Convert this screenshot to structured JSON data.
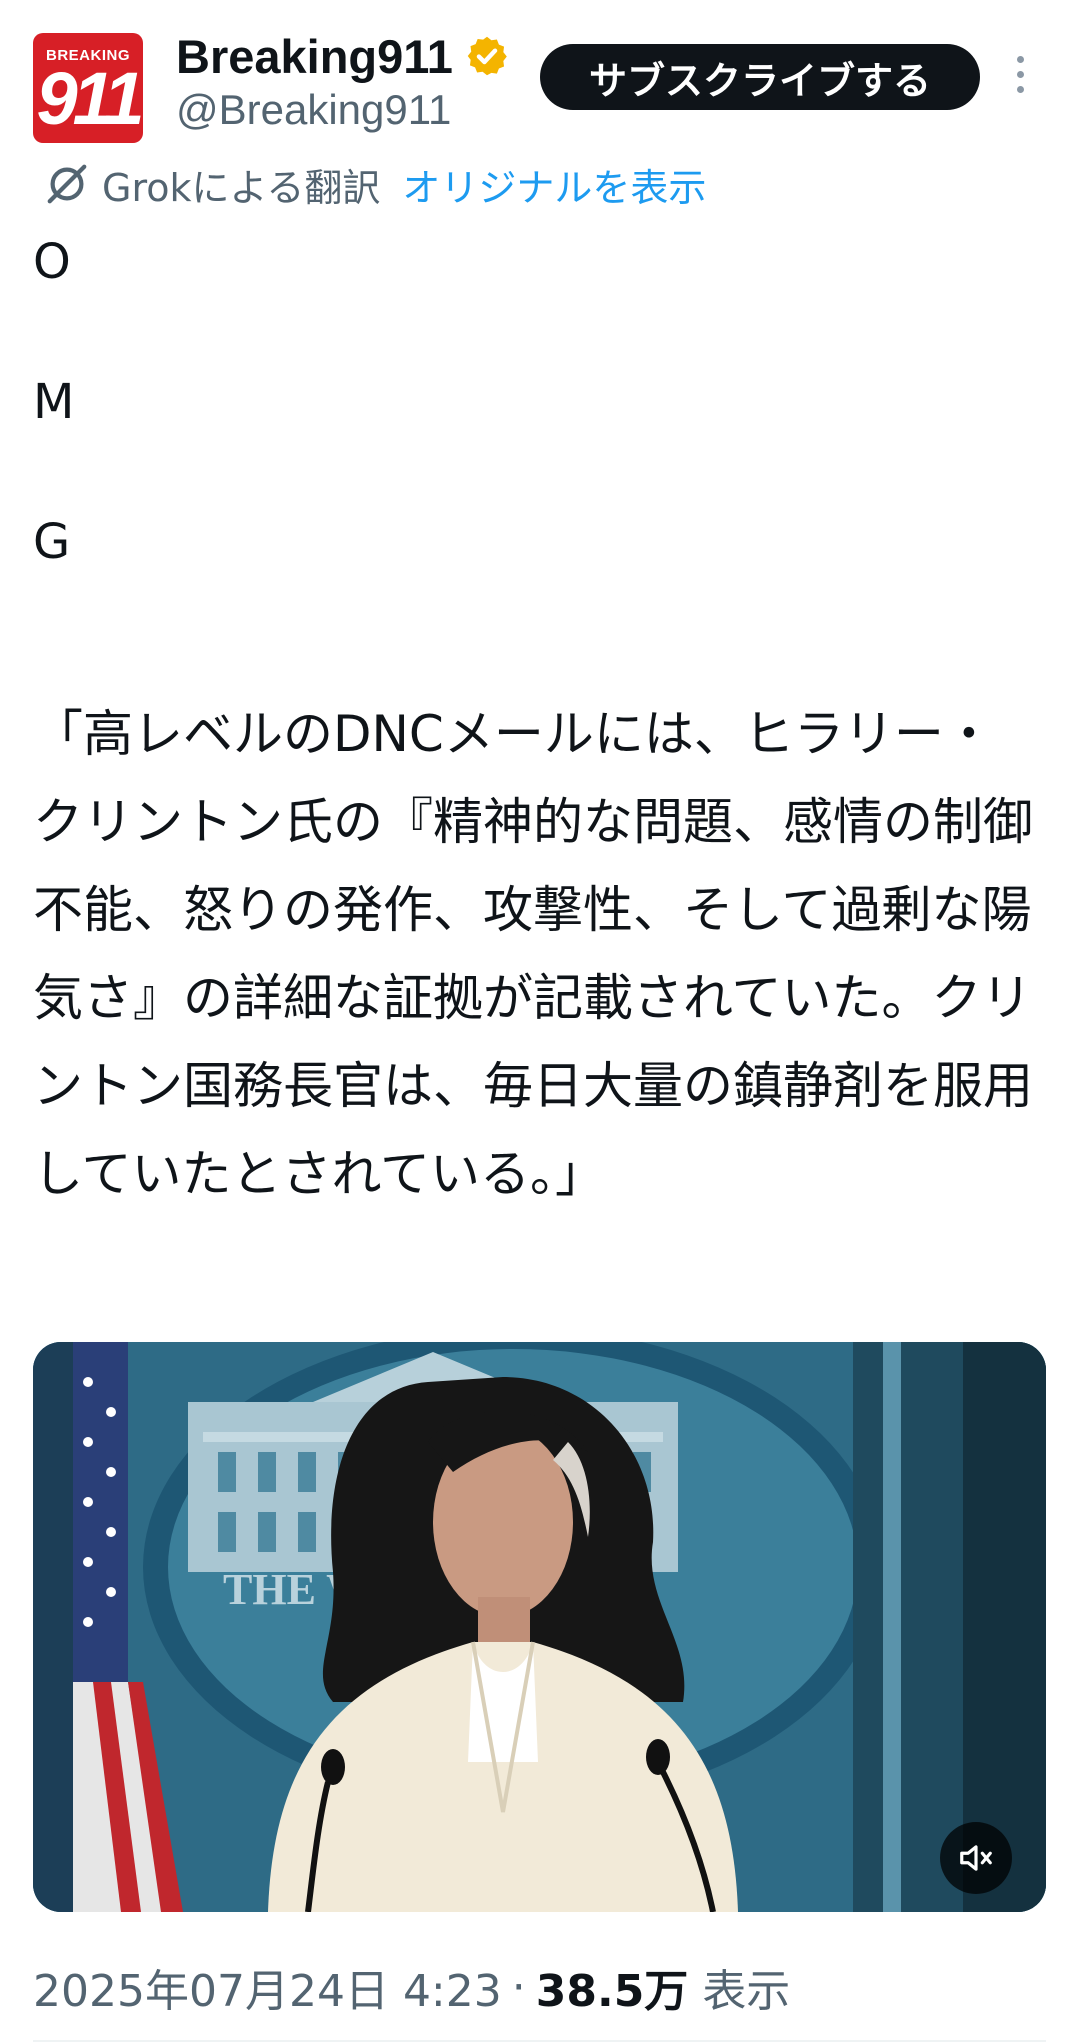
{
  "header": {
    "avatar_top_text": "BREAKING",
    "avatar_number": "911",
    "display_name": "Breaking911",
    "handle": "@Breaking911",
    "verified_color": "#f4b400",
    "subscribe_label": "サブスクライブする",
    "more_icon": "more-vertical-icon"
  },
  "translation": {
    "icon": "grok-icon",
    "by_label": "Grokによる翻訳",
    "show_original_label": "オリジナルを表示",
    "link_color": "#1d9bf0"
  },
  "tweet": {
    "letters": [
      "O",
      "M",
      "G"
    ],
    "body": "「高レベルのDNCメールには、ヒラリー・クリントン氏の『精神的な問題、感情の制御不能、怒りの発作、攻撃性、そして過剰な陽気さ』の詳細な証拠が記載されていた。クリントン国務長官は、毎日大量の鎮静剤を服用していたとされている。」"
  },
  "media": {
    "type": "video",
    "backdrop_text": "THE W          USE",
    "mute_icon": "volume-mute-icon"
  },
  "meta": {
    "date": "2025年07月24日 4:23",
    "separator": "·",
    "views": "38.5万",
    "views_label": "表示"
  }
}
